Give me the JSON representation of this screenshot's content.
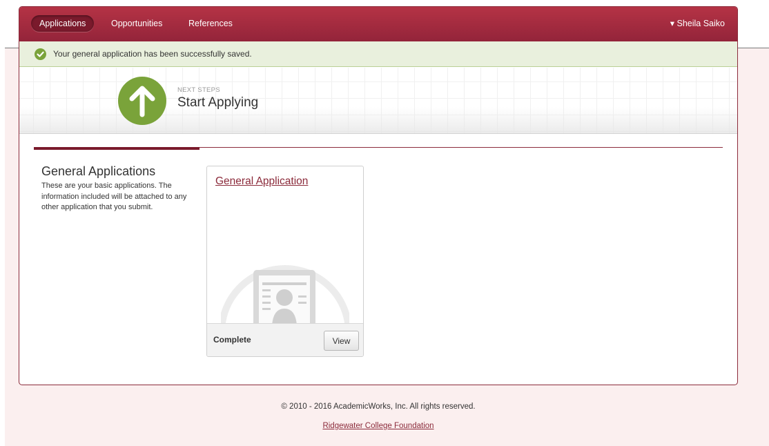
{
  "nav": {
    "tabs": [
      {
        "label": "Applications",
        "active": true
      },
      {
        "label": "Opportunities",
        "active": false
      },
      {
        "label": "References",
        "active": false
      }
    ],
    "user": "▾ Sheila Saiko"
  },
  "alert": {
    "icon": "check-circle-icon",
    "message": "Your general application has been successfully saved."
  },
  "hero": {
    "icon": "arrow-up-icon",
    "small_label": "NEXT STEPS",
    "title": "Start Applying"
  },
  "section": {
    "title": "General Applications",
    "description": "These are your basic applications. The information included will be attached to any other application that you submit."
  },
  "card": {
    "title": "General Application",
    "icon": "id-card-icon",
    "status": "Complete",
    "button": "View"
  },
  "footer": {
    "copyright": "© 2010 - 2016 AcademicWorks, Inc. All rights reserved.",
    "link": "Ridgewater College Foundation"
  },
  "colors": {
    "brand": "#a52a3e",
    "brand_dark": "#7a1a2c",
    "success": "#7aa33a",
    "page_bg": "#fbefef"
  }
}
